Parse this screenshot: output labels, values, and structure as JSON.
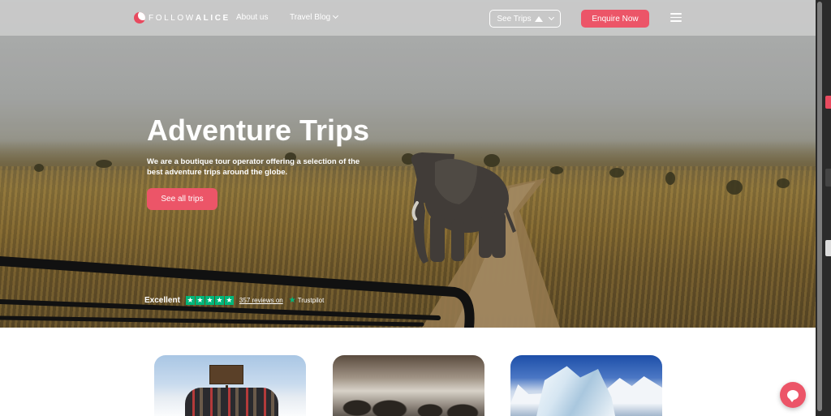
{
  "nav": {
    "logo": {
      "part1": "FOLLOW",
      "part2": "ALICE"
    },
    "links": [
      {
        "label": "About us"
      },
      {
        "label": "Travel Blog"
      }
    ],
    "see_trips_label": "See Trips",
    "enquire_label": "Enquire Now"
  },
  "hero": {
    "title": "Adventure Trips",
    "subtitle": "We are a boutique tour operator offering a selection of the best adventure trips around the globe.",
    "button_label": "See all trips"
  },
  "trustpilot": {
    "rating_word": "Excellent",
    "stars": 5,
    "reviews_text": "357 reviews on",
    "brand": "Trustpilot"
  },
  "colors": {
    "accent": "#ec5568",
    "trustpilot_green": "#00b67a"
  },
  "icons": [
    "logo-icon",
    "chevron-down-icon",
    "mountain-icon",
    "menu-icon",
    "star-icon",
    "chat-icon"
  ]
}
